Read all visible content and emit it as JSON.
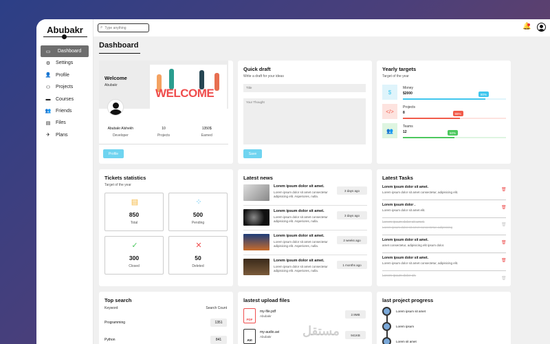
{
  "brand": "Abubakr",
  "sidebar": {
    "items": [
      {
        "label": "Dashboard",
        "icon": "gamepad-icon",
        "glyph": "▭"
      },
      {
        "label": "Settings",
        "icon": "gear-icon",
        "glyph": "⚙"
      },
      {
        "label": "Profile",
        "icon": "user-icon",
        "glyph": "👤"
      },
      {
        "label": "Projects",
        "icon": "diagram-icon",
        "glyph": "⚇"
      },
      {
        "label": "Courses",
        "icon": "graduation-cap-icon",
        "glyph": "▬"
      },
      {
        "label": "Friends",
        "icon": "users-icon",
        "glyph": "👥"
      },
      {
        "label": "Files",
        "icon": "server-icon",
        "glyph": "▤"
      },
      {
        "label": "Plans",
        "icon": "plane-icon",
        "glyph": "✈"
      }
    ]
  },
  "search": {
    "placeholder": "Type anything"
  },
  "page": {
    "title": "Dashboard"
  },
  "welcome": {
    "title": "Welcome",
    "name": "Abubakr",
    "image_word": "WELCOME",
    "stats": [
      {
        "value": "Abubakr Alshekh",
        "label": "Developer"
      },
      {
        "value": "10",
        "label": "Projects"
      },
      {
        "value": "1350$",
        "label": "Earned"
      }
    ],
    "button": "Profile"
  },
  "draft": {
    "title": "Quick draft",
    "subtitle": "Write a draft for your ideas",
    "title_placeholder": "Title",
    "body_placeholder": "Your Thought",
    "button": "Save"
  },
  "targets": {
    "title": "Yearly targets",
    "subtitle": "Target of the year",
    "items": [
      {
        "label": "Money",
        "value": "$2000",
        "percent": 80,
        "badge": "80%",
        "color": "#3fc6ee",
        "bg": "#dff4fb",
        "icon": "dollar-icon",
        "glyph": "$"
      },
      {
        "label": "Projects",
        "value": "8",
        "percent": 55,
        "badge": "55%",
        "color": "#f15b4a",
        "bg": "#fde3df",
        "icon": "code-icon",
        "glyph": "</>"
      },
      {
        "label": "Teams",
        "value": "12",
        "percent": 50,
        "badge": "50%",
        "color": "#4cc85e",
        "bg": "#def5e1",
        "icon": "users-icon",
        "glyph": "👥"
      }
    ]
  },
  "tickets": {
    "title": "Tickets statistics",
    "subtitle": "Target of the year",
    "items": [
      {
        "value": "850",
        "label": "Total",
        "icon": "list-icon",
        "glyph": "▤",
        "color": "#f5b841"
      },
      {
        "value": "500",
        "label": "Pending",
        "icon": "spinner-icon",
        "glyph": "⁘",
        "color": "#3fb8ee"
      },
      {
        "value": "300",
        "label": "Closed",
        "icon": "check-circle-icon",
        "glyph": "✓",
        "color": "#4cc85e"
      },
      {
        "value": "50",
        "label": "Deleted",
        "icon": "close-box-icon",
        "glyph": "✕",
        "color": "#ef4d4d"
      }
    ]
  },
  "news": {
    "title": "Latest news",
    "items": [
      {
        "title": "Lorem ipsum dolor sit amet.",
        "text": "Lorem ipsum dolor sit amet consectetur adipisicing elit. Asperiores, nulla.",
        "date": "3 days ago"
      },
      {
        "title": "Lorem ipsum dolor sit amet.",
        "text": "Lorem ipsum dolor sit amet consectetur adipisicing elit. Asperiores, nulla.",
        "date": "3 days ago"
      },
      {
        "title": "Lorem ipsum dolor sit amet.",
        "text": "Lorem ipsum dolor sit amet consectetur adipisicing elit. Asperiores, nulla.",
        "date": "2 weeks ago"
      },
      {
        "title": "Lorem ipsum dolor sit amet.",
        "text": "Lorem ipsum dolor sit amet consectetur adipisicing elit. Asperiores, nulla.",
        "date": "1 months ago"
      }
    ]
  },
  "tasks": {
    "title": "Latest Tasks",
    "items": [
      {
        "title": "Lorem ipsum dolor sit amet.",
        "text": "Lorem ipsum dolor sit amet consectetur, adipisicing elit.",
        "done": false
      },
      {
        "title": "Lorem ipsum dolor .",
        "text": "Lorem ipsum dolor sit amet elit.",
        "done": false
      },
      {
        "title": "Lorem ipsum dolor sit amet.",
        "text": "Lorem ipsum dolor sit amet consectetur, adipisicing",
        "done": true
      },
      {
        "title": "Lorem ipsum dolor sit amet.",
        "text": "amet consectetur, adipisicing elit ipsum dolor.",
        "done": false
      },
      {
        "title": "Lorem ipsum dolor sit amet.",
        "text": "Lorem ipsum dolor sit amet consectetur, adipisicing elit.",
        "done": false
      },
      {
        "title": "Lorem ipsum dolor sit.",
        "text": "",
        "done": true
      }
    ]
  },
  "top_search": {
    "title": "Top search",
    "keyword_header": "Keyword",
    "count_header": "Search Count",
    "rows": [
      {
        "keyword": "Programming",
        "count": "1351"
      },
      {
        "keyword": "Python",
        "count": "841"
      }
    ]
  },
  "uploads": {
    "title": "lastest upload files",
    "items": [
      {
        "name": "my-file.pdf",
        "by": "Abubakr",
        "size": "2.9MB",
        "type": "PDF",
        "icon": "pdf-file-icon"
      },
      {
        "name": "my-audio.avi",
        "by": "Abubakr",
        "size": "941KB",
        "type": "AVI",
        "icon": "avi-file-icon"
      }
    ]
  },
  "progress": {
    "title": "last project progress",
    "items": [
      {
        "text": "Lorem ipsum sit amet"
      },
      {
        "text": "Lorem ipsum"
      },
      {
        "text": "Lorem sit amet"
      }
    ]
  },
  "watermark": "مستقل"
}
